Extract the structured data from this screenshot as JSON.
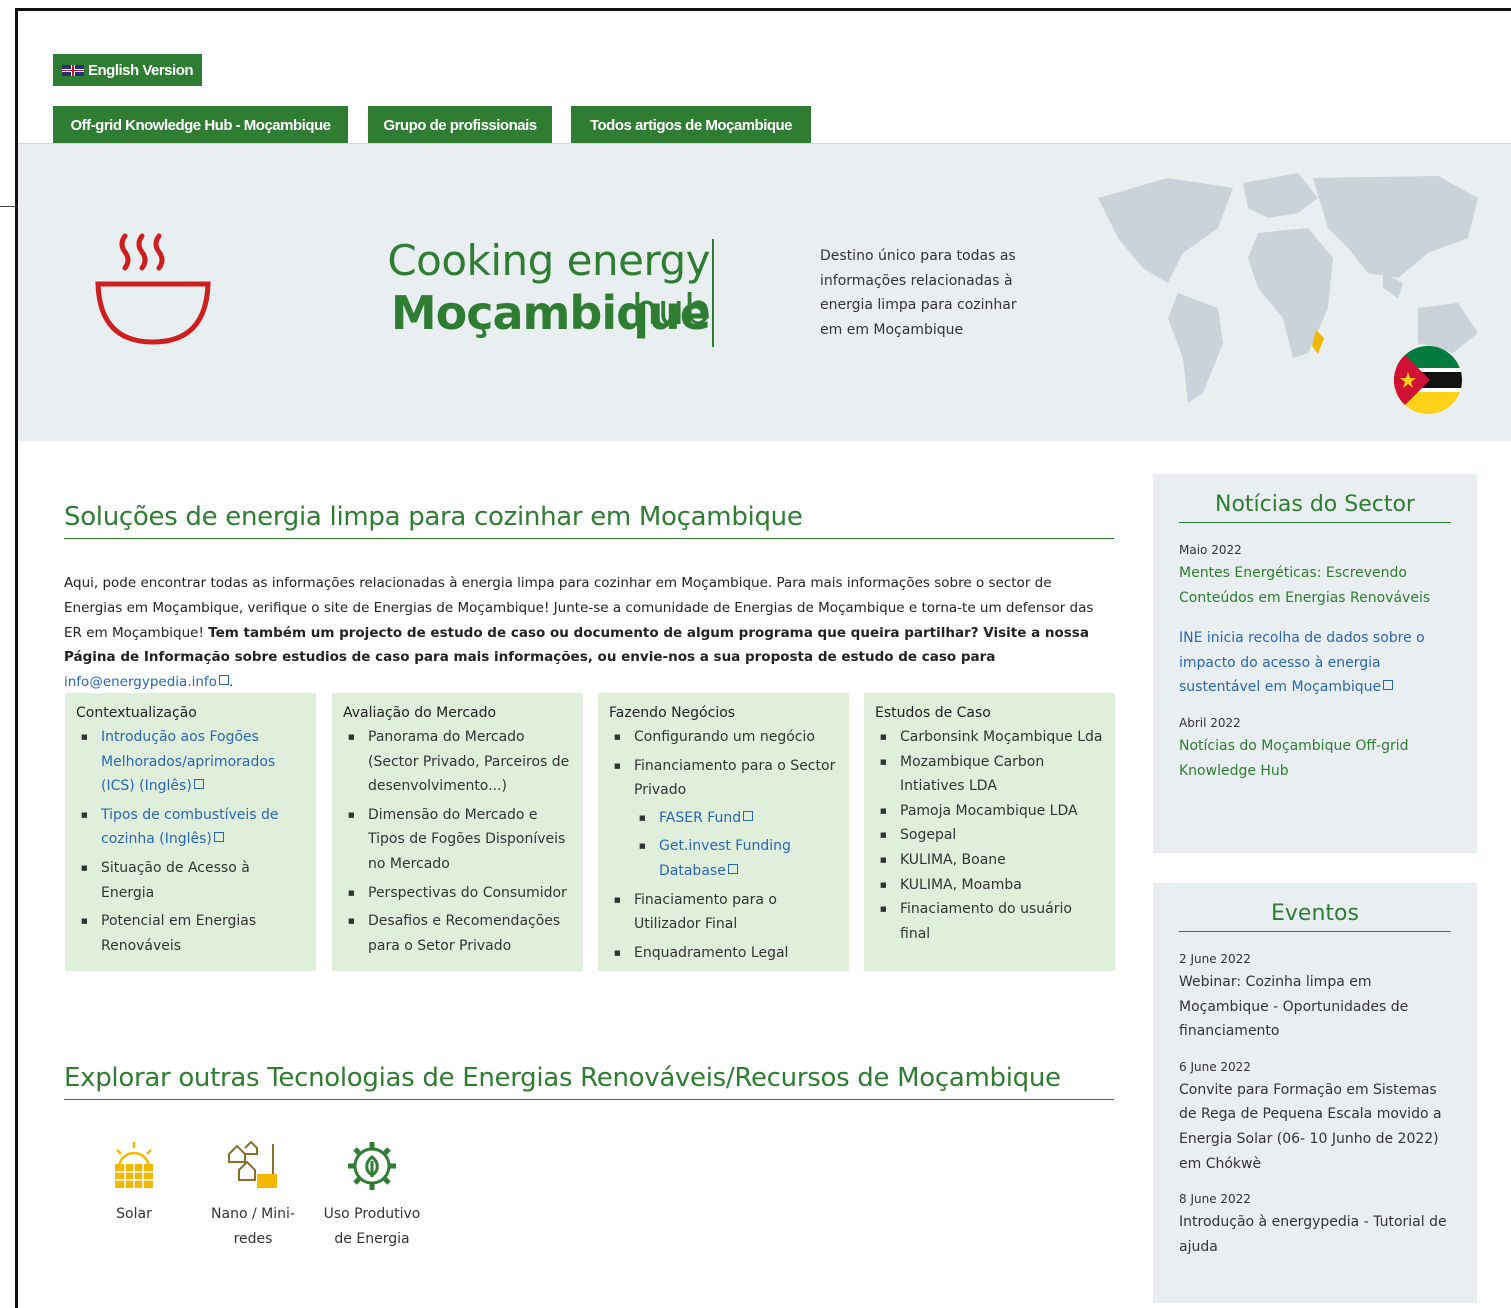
{
  "header": {
    "english_btn": "English Version",
    "nav": [
      "Off-grid Knowledge Hub - Moçambique",
      "Grupo de profissionais",
      "Todos artigos de Moçambique"
    ]
  },
  "hero": {
    "title_line1": "Cooking energy hub",
    "title_line2": "Moçambique",
    "description": "Destino único para todas as informações relacionadas à energia limpa para cozinhar em em Moçambique"
  },
  "section1": {
    "title": "Soluções de energia limpa para cozinhar em Moçambique",
    "intro_plain": "Aqui, pode encontrar todas as informações relacionadas à energia limpa para cozinhar em Moçambique. Para mais informações sobre o sector de Energias em Moçambique, verifique o site de Energias de Moçambique! Junte-se a comunidade de Energias de Moçambique e torna-te um defensor das ER em Moçambique! ",
    "intro_bold": "Tem também um projecto de estudo de caso ou documento de algum programa que queira partilhar? Visite a nossa Página de Informação sobre estudios de caso para mais informações, ou envie-nos a sua proposta de estudo de caso para ",
    "intro_email": "info@energypedia.info",
    "intro_end": "."
  },
  "boxes": [
    {
      "title": "Contextualização",
      "items": [
        "Introdução aos Fogões Melhorados/aprimorados (ICS) (Inglês)",
        "Tipos de combustíveis de cozinha (Inglês)",
        "Situação de Acesso à Energia",
        "Potencial em Energias Renováveis"
      ]
    },
    {
      "title": "Avaliação do Mercado",
      "items": [
        "Panorama do Mercado (Sector Privado, Parceiros de desenvolvimento...)",
        "Dimensão do Mercado e Tipos de Fogões Disponíveis no Mercado",
        "Perspectivas do Consumidor",
        "Desafios e Recomendações para o Setor Privado"
      ]
    },
    {
      "title": "Fazendo Negócios",
      "items": [
        "Configurando um negócio",
        "Financiamento para o Sector Privado",
        "FASER Fund",
        "Get.invest Funding Database",
        "Finaciamento para o Utilizador Final",
        "Enquadramento Legal"
      ]
    },
    {
      "title": "Estudos de Caso",
      "items": [
        "Carbonsink Moçambique Lda",
        "Mozambique Carbon Intiatives LDA",
        "Pamoja Mocambique LDA",
        "Sogepal",
        "KULIMA, Boane",
        "KULIMA, Moamba",
        "Finaciamento do usuário final"
      ]
    }
  ],
  "section2": {
    "title": "Explorar outras Tecnologias de Energias Renováveis/Recursos de Moçambique",
    "tiles": [
      "Solar",
      "Nano / Mini-redes",
      "Uso Produtivo de Energia"
    ]
  },
  "news": {
    "title": "Notícias do Sector",
    "items": [
      {
        "date": "Maio 2022",
        "text": "Mentes Energéticas: Escrevendo Conteúdos em Energias Renováveis"
      },
      {
        "date": "",
        "text": "INE inicia recolha de dados sobre o impacto do acesso à energia sustentável em Moçambique"
      },
      {
        "date": "Abril 2022",
        "text": "Notícias do Moçambique Off-grid Knowledge Hub"
      }
    ]
  },
  "events": {
    "title": "Eventos",
    "items": [
      {
        "date": "2 June 2022",
        "text": "Webinar: Cozinha limpa em Moçambique - Oportunidades de financiamento"
      },
      {
        "date": "6 June 2022",
        "text": "Convite para Formação em Sistemas de Rega de Pequena Escala movido a Energia Solar (06- 10 Junho de 2022) em Chókwè"
      },
      {
        "date": "8 June 2022",
        "text": "Introdução à energypedia - Tutorial de ajuda"
      }
    ]
  },
  "colors": {
    "brand_green": "#2e7d32",
    "link_blue": "#2a66b3",
    "box_green": "#e0efdc",
    "panel_gray": "#e9eef1",
    "icon_red": "#cc1f1f",
    "icon_yellow": "#f5b800"
  }
}
